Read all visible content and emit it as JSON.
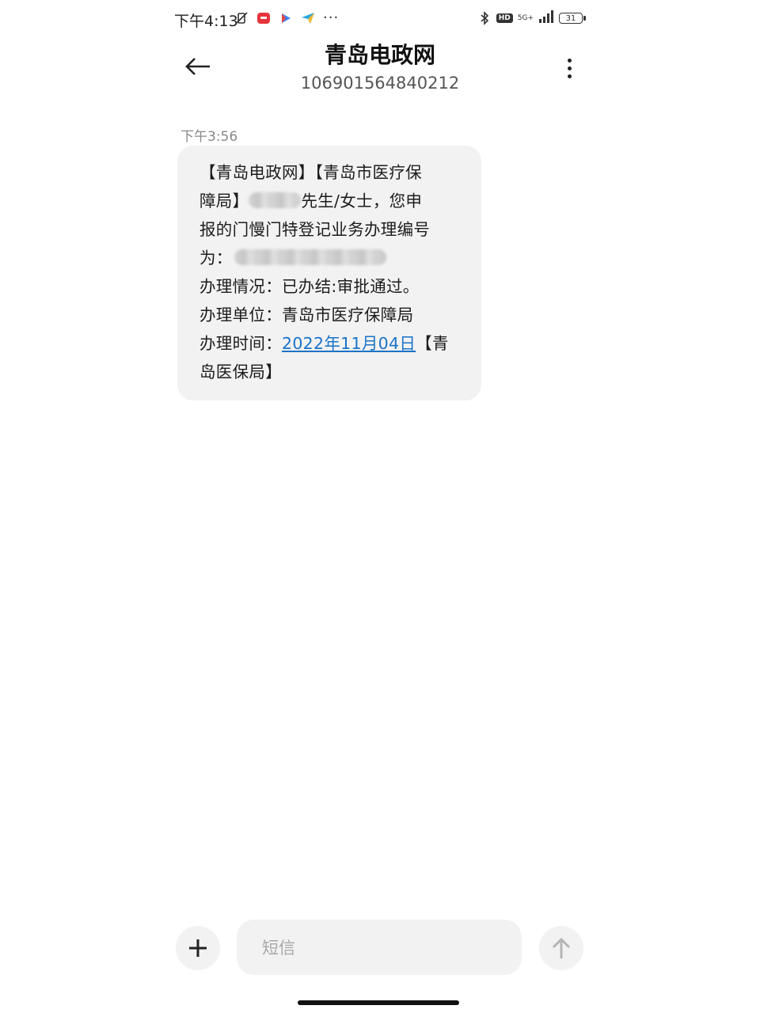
{
  "status_bar": {
    "time": "下午4:13",
    "more": "···",
    "hd": "HD",
    "network": "5G+",
    "battery": "31"
  },
  "header": {
    "title": "青岛电政网",
    "subtitle": "106901564840212"
  },
  "message": {
    "time": "下午3:56",
    "lines": {
      "l1": "【青岛电政网】【青岛市医疗保",
      "l2a": "障局】",
      "l2b": "先生/女士，您申",
      "l3": "报的门慢门特登记业务办理编号",
      "l4": "为：",
      "l5": "办理情况：已办结:审批通过。",
      "l6": "办理单位：青岛市医疗保障局",
      "l7a": "办理时间：",
      "l7_date": "2022年11月04日",
      "l7b": "【青",
      "l8": "岛医保局】"
    }
  },
  "composer": {
    "placeholder": "短信",
    "add_label": "+"
  },
  "colors": {
    "bubble": "#f2f2f2",
    "link": "#1a73c8",
    "background": "#ffffff"
  }
}
